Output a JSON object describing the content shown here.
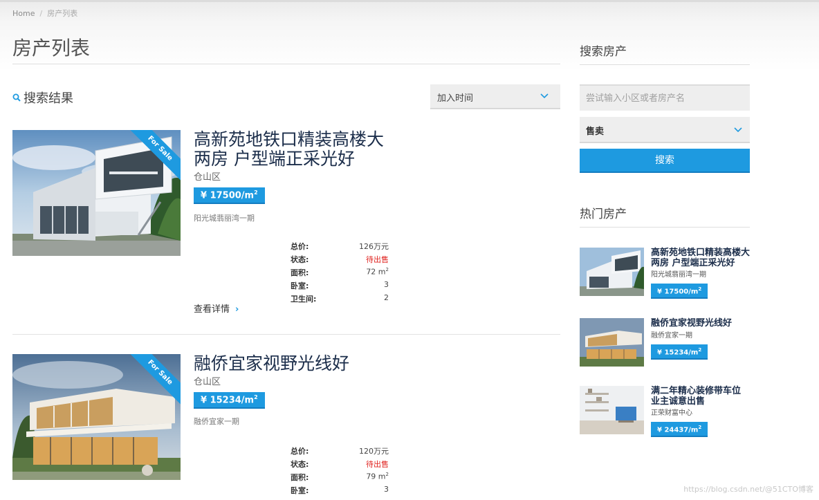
{
  "breadcrumb": {
    "home": "Home",
    "current": "房产列表"
  },
  "page_title": "房产列表",
  "results": {
    "label": "搜索结果",
    "sort_value": "加入时间"
  },
  "listings": [
    {
      "title": "高新苑地铁口精装高楼大两房 户型端正采光好",
      "ribbon": "For Sale",
      "district": "仓山区",
      "price_label": "¥ 17500/m",
      "price_sup": "2",
      "community": "阳光城翡丽湾一期",
      "specs": [
        {
          "k": "总价:",
          "v": "126万元"
        },
        {
          "k": "状态:",
          "v": "待出售"
        },
        {
          "k": "面积:",
          "v": "72 m",
          "sup": "2"
        },
        {
          "k": "卧室:",
          "v": "3"
        },
        {
          "k": "卫生间:",
          "v": "2"
        }
      ],
      "details": "查看详情"
    },
    {
      "title": "融侨宜家视野光线好",
      "ribbon": "For Sale",
      "district": "仓山区",
      "price_label": "¥ 15234/m",
      "price_sup": "2",
      "community": "融侨宜家一期",
      "specs": [
        {
          "k": "总价:",
          "v": "120万元"
        },
        {
          "k": "状态:",
          "v": "待出售"
        },
        {
          "k": "面积:",
          "v": "79 m",
          "sup": "2"
        },
        {
          "k": "卧室:",
          "v": "3"
        }
      ]
    }
  ],
  "sidebar": {
    "search_title": "搜索房产",
    "search_placeholder": "尝试输入小区或者房产名",
    "sale_value": "售卖",
    "search_button": "搜索",
    "hot_title": "热门房产",
    "hot": [
      {
        "title": "高新苑地铁口精装高楼大两房 户型端正采光好",
        "sub": "阳光城翡丽湾一期",
        "price": "¥ 17500/m",
        "sup": "2"
      },
      {
        "title": "融侨宜家视野光线好",
        "sub": "融侨宜家一期",
        "price": "¥ 15234/m",
        "sup": "2"
      },
      {
        "title": "满二年精心装修带车位 业主诚意出售",
        "sub": "正荣财富中心",
        "price": "¥ 24437/m",
        "sup": "2"
      }
    ]
  },
  "watermark": "https://blog.csdn.net/@51CTO博客",
  "colors": {
    "accent": "#1e9ae0",
    "status_red": "#e0231f",
    "title_navy": "#1b2d4a"
  }
}
